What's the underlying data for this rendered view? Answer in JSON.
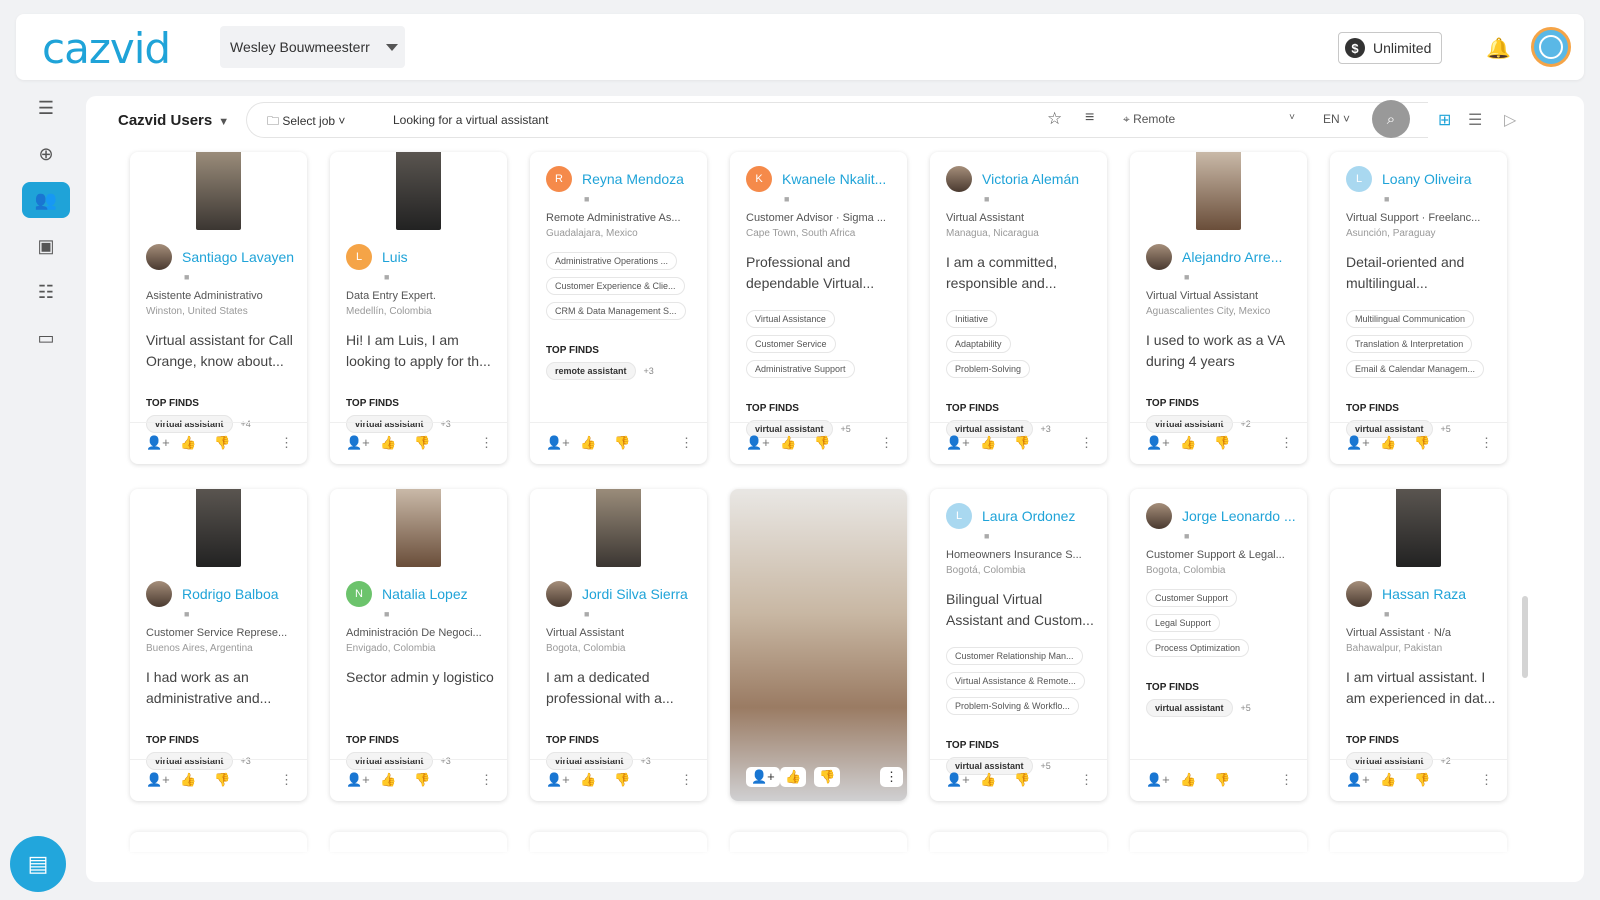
{
  "header": {
    "logo_main": "cazvid",
    "workspace_name": "Wesley Bouwmeesterr",
    "plan_label": "Unlimited"
  },
  "filter": {
    "title": "Cazvid Users",
    "select_job": "Select job",
    "query": "Looking for a virtual assistant",
    "location": "Remote",
    "language": "EN"
  },
  "labels": {
    "top_finds": "TOP FINDS"
  },
  "colors": {
    "accent": "#1fa3d8",
    "logo_accent": "#f29a3a"
  },
  "cards": [
    {
      "name": "Santiago Lavayen",
      "role": "Asistente Administrativo",
      "place": "Winston, United States",
      "bio": "Virtual assistant for Call Orange, know about...",
      "tags": [],
      "find": "virtual assistant",
      "more": "+4",
      "photo": true,
      "avatar": "photo"
    },
    {
      "name": "Luis",
      "role": "Data Entry Expert.",
      "place": "Medellín, Colombia",
      "bio": "Hi! I am Luis, I am looking to apply for th...",
      "tags": [],
      "find": "virtual assistant",
      "more": "+3",
      "photo": true,
      "avatar": "L",
      "avatar_color": "#f5a447"
    },
    {
      "name": "Reyna Mendoza",
      "role": "Remote Administrative As...",
      "place": "Guadalajara, Mexico",
      "bio": "",
      "tags": [
        "Administrative Operations ...",
        "Customer Experience & Clie...",
        "CRM & Data Management S..."
      ],
      "find": "remote assistant",
      "more": "+3",
      "photo": false,
      "avatar": "R",
      "avatar_color": "#f58a4a"
    },
    {
      "name": "Kwanele Nkalit...",
      "role": "Customer Advisor · Sigma ...",
      "place": "Cape Town, South Africa",
      "bio": "Professional and dependable Virtual...",
      "tags": [
        "Virtual Assistance",
        "Customer Service",
        "Administrative Support"
      ],
      "find": "virtual assistant",
      "more": "+5",
      "photo": false,
      "avatar": "K",
      "avatar_color": "#f58a4a"
    },
    {
      "name": "Victoria Alemán",
      "role": "Virtual Assistant",
      "place": "Managua, Nicaragua",
      "bio": "I am a committed, responsible and...",
      "tags": [
        "Initiative",
        "Adaptability",
        "Problem-Solving"
      ],
      "find": "virtual assistant",
      "more": "+3",
      "photo": false,
      "avatar": "photo"
    },
    {
      "name": "Alejandro Arre...",
      "role": "Virtual Virtual Assistant",
      "place": "Aguascalientes City, Mexico",
      "bio": "I used to work as a VA during 4 years",
      "tags": [],
      "find": "virtual assistant",
      "more": "+2",
      "photo": true,
      "avatar": "photo"
    },
    {
      "name": "Loany Oliveira",
      "role": "Virtual Support · Freelanc...",
      "place": "Asunción, Paraguay",
      "bio": "Detail-oriented and multilingual...",
      "tags": [
        "Multilingual Communication",
        "Translation & Interpretation",
        "Email & Calendar Managem..."
      ],
      "find": "virtual assistant",
      "more": "+5",
      "photo": false,
      "avatar": "L",
      "avatar_color": "#a9d8f0"
    },
    {
      "name": "Rodrigo Balboa",
      "role": "Customer Service Represe...",
      "place": "Buenos Aires, Argentina",
      "bio": "I had work as an administrative and...",
      "tags": [],
      "find": "virtual assistant",
      "more": "+3",
      "photo": true,
      "avatar": "photo"
    },
    {
      "name": "Natalia Lopez",
      "role": "Administración De Negoci...",
      "place": "Envigado, Colombia",
      "bio": "Sector admin y logistico",
      "tags": [],
      "find": "virtual assistant",
      "more": "+3",
      "photo": true,
      "avatar": "N",
      "avatar_color": "#6cc36c"
    },
    {
      "name": "Jordi Silva Sierra",
      "role": "Virtual Assistant",
      "place": "Bogota, Colombia",
      "bio": "I am a dedicated professional with a...",
      "tags": [],
      "find": "virtual assistant",
      "more": "+3",
      "photo": true,
      "avatar": "photo"
    },
    {
      "name": "",
      "role": "",
      "place": "",
      "bio": "",
      "tags": [],
      "find": "",
      "more": "",
      "photo": false,
      "avatar": "none",
      "big": true
    },
    {
      "name": "Laura Ordonez",
      "role": "Homeowners Insurance S...",
      "place": "Bogotá, Colombia",
      "bio": "Bilingual Virtual Assistant and Custom...",
      "tags": [
        "Customer Relationship Man...",
        "Virtual Assistance & Remote...",
        "Problem-Solving & Workflo..."
      ],
      "find": "virtual assistant",
      "more": "+5",
      "photo": false,
      "avatar": "L",
      "avatar_color": "#a9d8f0"
    },
    {
      "name": "Jorge Leonardo ...",
      "role": "Customer Support & Legal...",
      "place": "Bogota, Colombia",
      "bio": "",
      "tags": [
        "Customer Support",
        "Legal Support",
        "Process Optimization"
      ],
      "find": "virtual assistant",
      "more": "+5",
      "photo": false,
      "avatar": "photo"
    },
    {
      "name": "Hassan Raza",
      "role": "Virtual Assistant · N/a",
      "place": "Bahawalpur, Pakistan",
      "bio": "I am virtual assistant. I am experienced in dat...",
      "tags": [],
      "find": "virtual assistant",
      "more": "+2",
      "photo": true,
      "avatar": "photo"
    }
  ]
}
